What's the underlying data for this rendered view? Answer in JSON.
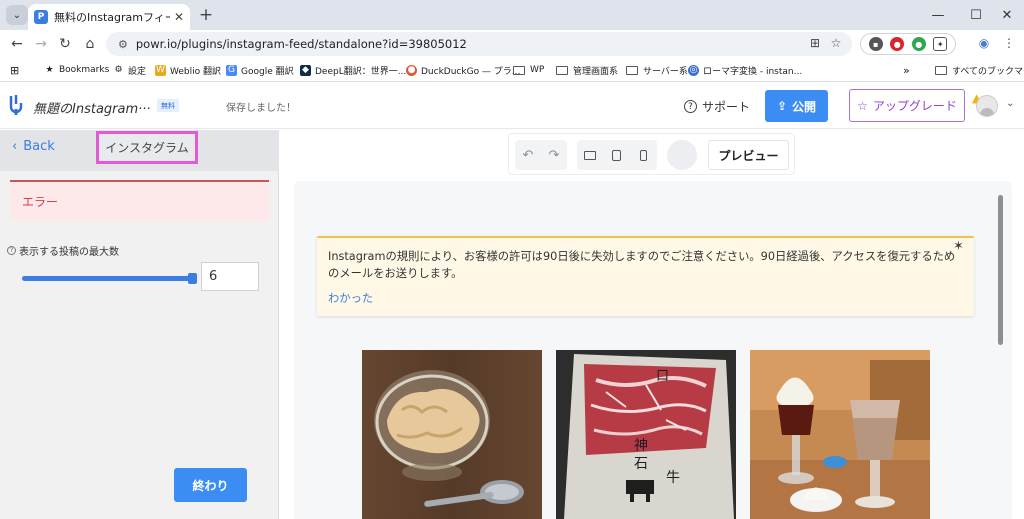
{
  "browser": {
    "tab_title": "無料のInstagramフィードソフトウェア",
    "url": "powr.io/plugins/instagram-feed/standalone?id=39805012",
    "window_controls": [
      "minimize-icon",
      "maximize-icon",
      "close-icon"
    ]
  },
  "bookmarks": {
    "items": [
      {
        "label": "Bookmarks",
        "icon": "star-icon"
      },
      {
        "label": "設定",
        "icon": "gear-icon"
      },
      {
        "label": "Weblio 翻訳",
        "icon": "weblio-icon"
      },
      {
        "label": "Google 翻訳",
        "icon": "google-translate-icon"
      },
      {
        "label": "DeepL翻訳：世界一...",
        "icon": "deepl-icon"
      },
      {
        "label": "DuckDuckGo — プラ...",
        "icon": "duckduckgo-icon"
      },
      {
        "label": "WP",
        "icon": "folder-icon"
      },
      {
        "label": "管理画面系",
        "icon": "folder-icon"
      },
      {
        "label": "サーバー系",
        "icon": "folder-icon"
      },
      {
        "label": "ローマ字変換 - instan...",
        "icon": "globe-icon"
      }
    ],
    "all_bookmarks": "すべてのブックマーク"
  },
  "app": {
    "widget_title": "無題のInstagram···",
    "free_badge": "無料",
    "saved_text": "保存しました！",
    "support_label": "サポート",
    "publish_label": "公開",
    "upgrade_label": "アップグレード"
  },
  "editor": {
    "back_label": "Back",
    "tab_label": "インスタグラム",
    "error_text": "エラー",
    "max_posts_label": "表示する投稿の最大数",
    "max_posts_value": "6",
    "slider_fraction": 1.0,
    "done_label": "終わり"
  },
  "preview": {
    "preview_label": "プレビュー",
    "notice_text": "Instagramの規則により、お客様の許可は90日後に失効しますのでご注意ください。90日経過後、アクセスを復元するためのメールをお送りします。",
    "notice_link": "わかった",
    "photos": [
      "ice-cream-bowl-photo",
      "wagyu-beef-menu-photo",
      "cafe-drinks-photo"
    ]
  },
  "colors": {
    "accent_blue": "#3b8df4",
    "upgrade_purple": "#8e44c9",
    "error_red": "#d0444b",
    "highlight_pink": "#e25ad6",
    "notice_yellow": "#f2c14e"
  }
}
